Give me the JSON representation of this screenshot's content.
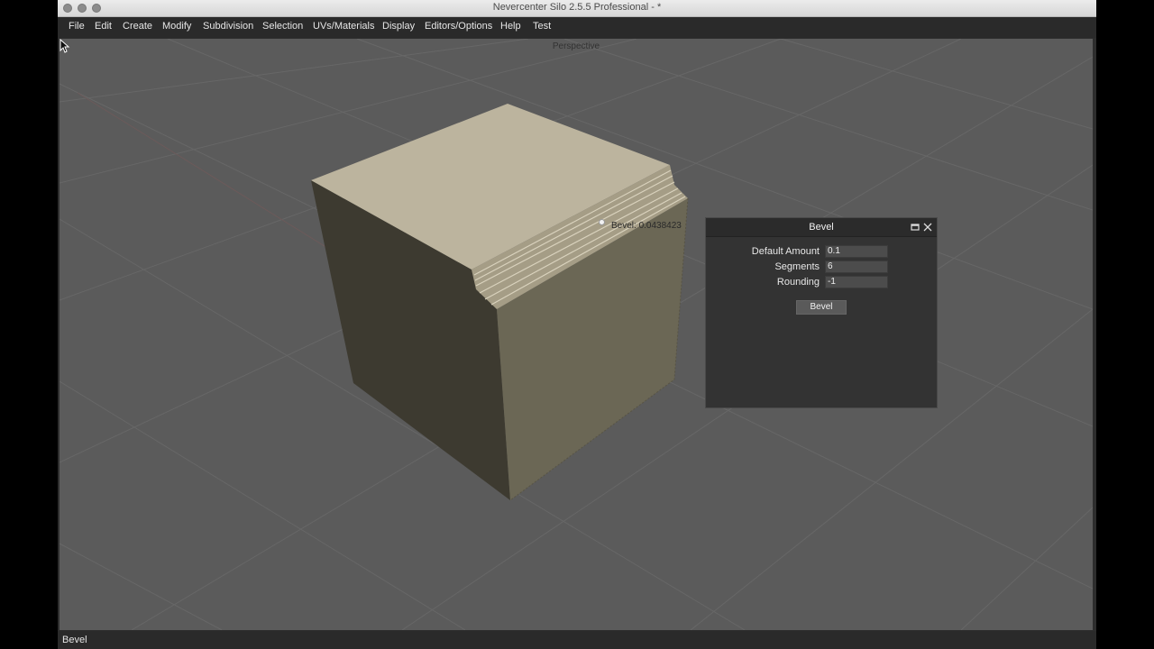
{
  "window": {
    "title": "Nevercenter Silo 2.5.5 Professional - *"
  },
  "menu": [
    "File",
    "Edit",
    "Create",
    "Modify",
    "Subdivision",
    "Selection",
    "UVs/Materials",
    "Display",
    "Editors/Options",
    "Help",
    "Test"
  ],
  "viewport": {
    "label": "Perspective",
    "bevel_readout": "Bevel: 0.0438423"
  },
  "bevel_panel": {
    "title": "Bevel",
    "fields": [
      {
        "label": "Default Amount",
        "value": "0.1"
      },
      {
        "label": "Segments",
        "value": "6"
      },
      {
        "label": "Rounding",
        "value": "-1"
      }
    ],
    "button_label": "Bevel"
  },
  "status": {
    "text": "Bevel"
  },
  "colors": {
    "viewport_bg": "#5b5b5b",
    "cube_top": "#bcb49e",
    "cube_left": "#3d3a30",
    "cube_right": "#6b6755",
    "panel_bg": "#333333"
  },
  "icons": [
    "maximize-icon",
    "close-icon",
    "cursor-icon"
  ]
}
